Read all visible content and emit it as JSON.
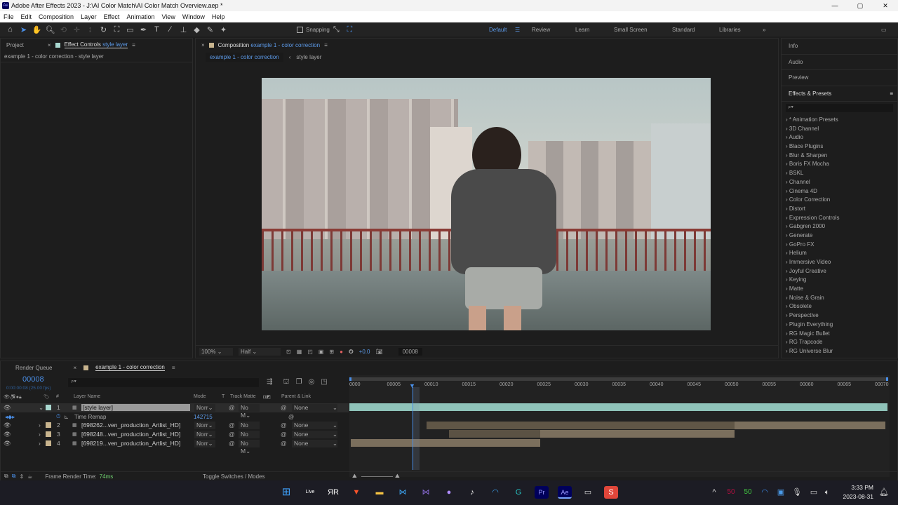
{
  "title": "Adobe After Effects 2023 - J:\\AI Color Match\\AI Color Match Overview.aep *",
  "menu": [
    "File",
    "Edit",
    "Composition",
    "Layer",
    "Effect",
    "Animation",
    "View",
    "Window",
    "Help"
  ],
  "toolbar": {
    "snapping": "Snapping"
  },
  "workspaces": [
    "Default",
    "Review",
    "Learn",
    "Small Screen",
    "Standard",
    "Libraries"
  ],
  "left_panel": {
    "tab_project": "Project",
    "tab_effect": "Effect Controls",
    "tab_effect_layer": "style layer",
    "subtitle": "example 1 - color correction - style layer"
  },
  "comp_panel": {
    "tab": "Composition",
    "tab_comp": "example 1 - color correction",
    "crumb1": "example 1 - color correction",
    "crumb2": "style layer",
    "zoom": "100%",
    "resolution": "Half",
    "exposure": "+0.0",
    "timecode": "00008"
  },
  "right_panel": {
    "headers": [
      "Info",
      "Audio",
      "Preview",
      "Effects & Presets"
    ],
    "effects": [
      "* Animation Presets",
      "3D Channel",
      "Audio",
      "Blace Plugins",
      "Blur & Sharpen",
      "Boris FX Mocha",
      "BSKL",
      "Channel",
      "Cinema 4D",
      "Color Correction",
      "Distort",
      "Expression Controls",
      "Gabgren 2000",
      "Generate",
      "GoPro FX",
      "Helium",
      "Immersive Video",
      "Joyful Creative",
      "Keying",
      "Matte",
      "Noise & Grain",
      "Obsolete",
      "Perspective",
      "Plugin Everything",
      "RG Magic Bullet",
      "RG Trapcode",
      "RG Universe Blur"
    ]
  },
  "timeline": {
    "tab_render": "Render Queue",
    "tab_comp": "example 1 - color correction",
    "timecode": "00008",
    "timecode_sub": "0:00:00:08 (25.00 fps)",
    "columns": {
      "layer_name": "Layer Name",
      "mode": "Mode",
      "t": "T",
      "track_matte": "Track Matte",
      "parent": "Parent & Link"
    },
    "layers": [
      {
        "num": "1",
        "name": "[style layer]",
        "mode": "Norr",
        "matte": "No M",
        "parent": "None",
        "color": "#a9d8d0"
      },
      {
        "num": "2",
        "name": "[698262...ven_production_Artlist_HD]",
        "mode": "Norr",
        "matte": "No M",
        "parent": "None",
        "color": "#c8b48e"
      },
      {
        "num": "3",
        "name": "[698248...ven_production_Artlist_HD]",
        "mode": "Norr",
        "matte": "No M",
        "parent": "None",
        "color": "#c8b48e"
      },
      {
        "num": "4",
        "name": "[698219...ven_production_Artlist_HD]",
        "mode": "Norr",
        "matte": "No M",
        "parent": "None",
        "color": "#c8b48e"
      }
    ],
    "time_remap": {
      "label": "Time Remap",
      "value": "142715"
    },
    "ruler": [
      "0000",
      "00005",
      "00010",
      "00015",
      "00020",
      "00025",
      "00030",
      "00035",
      "00040",
      "00045",
      "00050",
      "00055",
      "00060",
      "00065",
      "00070"
    ],
    "render_label": "Frame Render Time:",
    "render_value": "74ms",
    "toggle": "Toggle Switches / Modes"
  },
  "taskbar": {
    "time": "3:33 PM",
    "date": "2023-08-31",
    "tray1": "50",
    "tray2": "50",
    "live": "Live"
  }
}
